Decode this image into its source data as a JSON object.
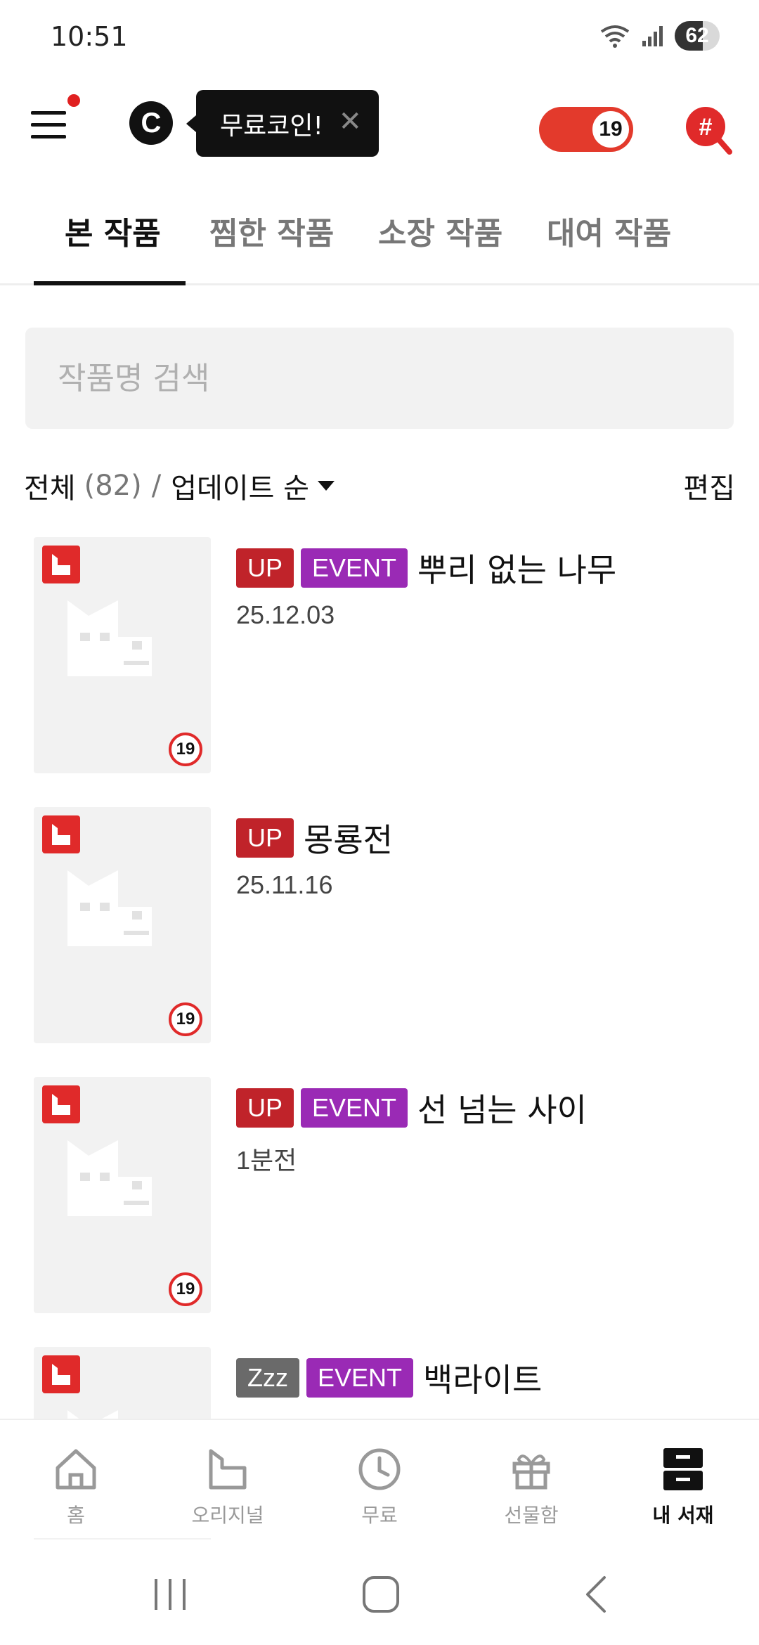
{
  "status_bar": {
    "time": "10:51",
    "battery": "62"
  },
  "header": {
    "coin_letter": "C",
    "tooltip_text": "무료코인!",
    "tooltip_close": "✕",
    "adult_badge": "19",
    "menu_notification": true
  },
  "tabs": [
    {
      "label": "본 작품",
      "active": true
    },
    {
      "label": "찜한 작품",
      "active": false
    },
    {
      "label": "소장 작품",
      "active": false
    },
    {
      "label": "대여 작품",
      "active": false
    }
  ],
  "search": {
    "placeholder": "작품명 검색"
  },
  "filter": {
    "all_label": "전체",
    "count": "(82)",
    "separator": "/",
    "sort_label": "업데이트 순",
    "edit_label": "편집"
  },
  "items": [
    {
      "tags": [
        "UP",
        "EVENT"
      ],
      "title": "뿌리 없는 나무",
      "date": "25.12.03",
      "age": "19"
    },
    {
      "tags": [
        "UP"
      ],
      "title": "몽룡전",
      "date": "25.11.16",
      "age": "19"
    },
    {
      "tags": [
        "UP",
        "EVENT"
      ],
      "title": "선 넘는 사이",
      "date": "1분전",
      "age": "19"
    },
    {
      "tags": [
        "Zzz",
        "EVENT"
      ],
      "title": "백라이트",
      "date": "",
      "age": ""
    }
  ],
  "bottom_nav": [
    {
      "label": "홈",
      "icon": "home-icon",
      "active": false
    },
    {
      "label": "오리지널",
      "icon": "original-icon",
      "active": false
    },
    {
      "label": "무료",
      "icon": "clock-icon",
      "active": false
    },
    {
      "label": "선물함",
      "icon": "gift-icon",
      "active": false
    },
    {
      "label": "내 서재",
      "icon": "library-icon",
      "active": true
    }
  ],
  "colors": {
    "accent": "#e02a2a",
    "up_tag": "#c0232a",
    "event_tag": "#9a2ab5",
    "zzz_tag": "#6a6a6a"
  }
}
